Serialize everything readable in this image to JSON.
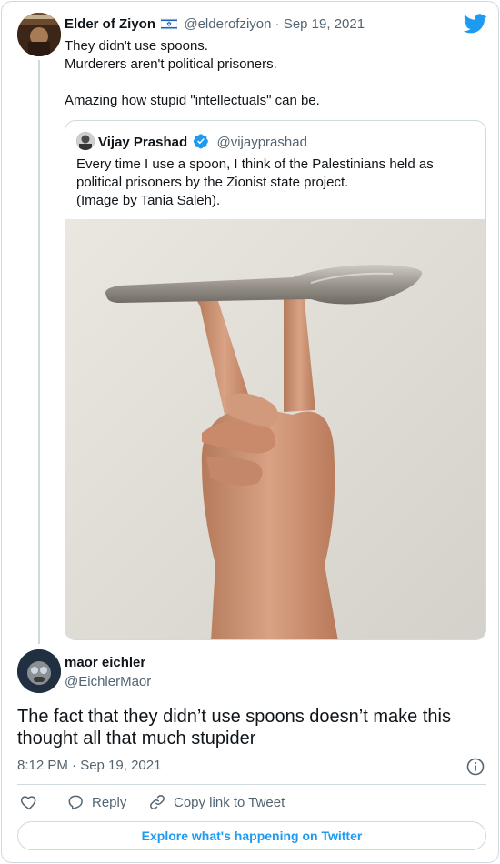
{
  "tweet": {
    "author_name": "Elder of Ziyon",
    "author_flag": "israel-flag-icon",
    "author_handle": "@elderofziyon",
    "separator": "·",
    "date": "Sep 19, 2021",
    "lines": [
      "They didn't use spoons.",
      "Murderers aren't political prisoners.",
      "Amazing how stupid \"intellectuals\" can be."
    ]
  },
  "quoted": {
    "author_name": "Vijay Prashad",
    "verified": "verified-badge-icon",
    "author_handle": "@vijayprashad",
    "lines": [
      "Every time I use a spoon, I think of the Palestinians held as",
      "political prisoners by the Zionist state project.",
      "(Image by Tania Saleh)."
    ],
    "image": "photo-hand-balancing-spoon"
  },
  "reply": {
    "author_name": "maor eichler",
    "author_handle": "@EichlerMaor",
    "text": "The fact that they didn’t use spoons doesn’t make this thought all that much stupider",
    "time": "8:12 PM · Sep 19, 2021"
  },
  "actions": {
    "like_icon": "heart-icon",
    "reply_label": "Reply",
    "copy_label": "Copy link to Tweet"
  },
  "explore_label": "Explore what's happening on Twitter",
  "colors": {
    "accent": "#1d9bf0",
    "text": "#0f1419",
    "muted": "#536471",
    "border": "#cfd9de"
  }
}
